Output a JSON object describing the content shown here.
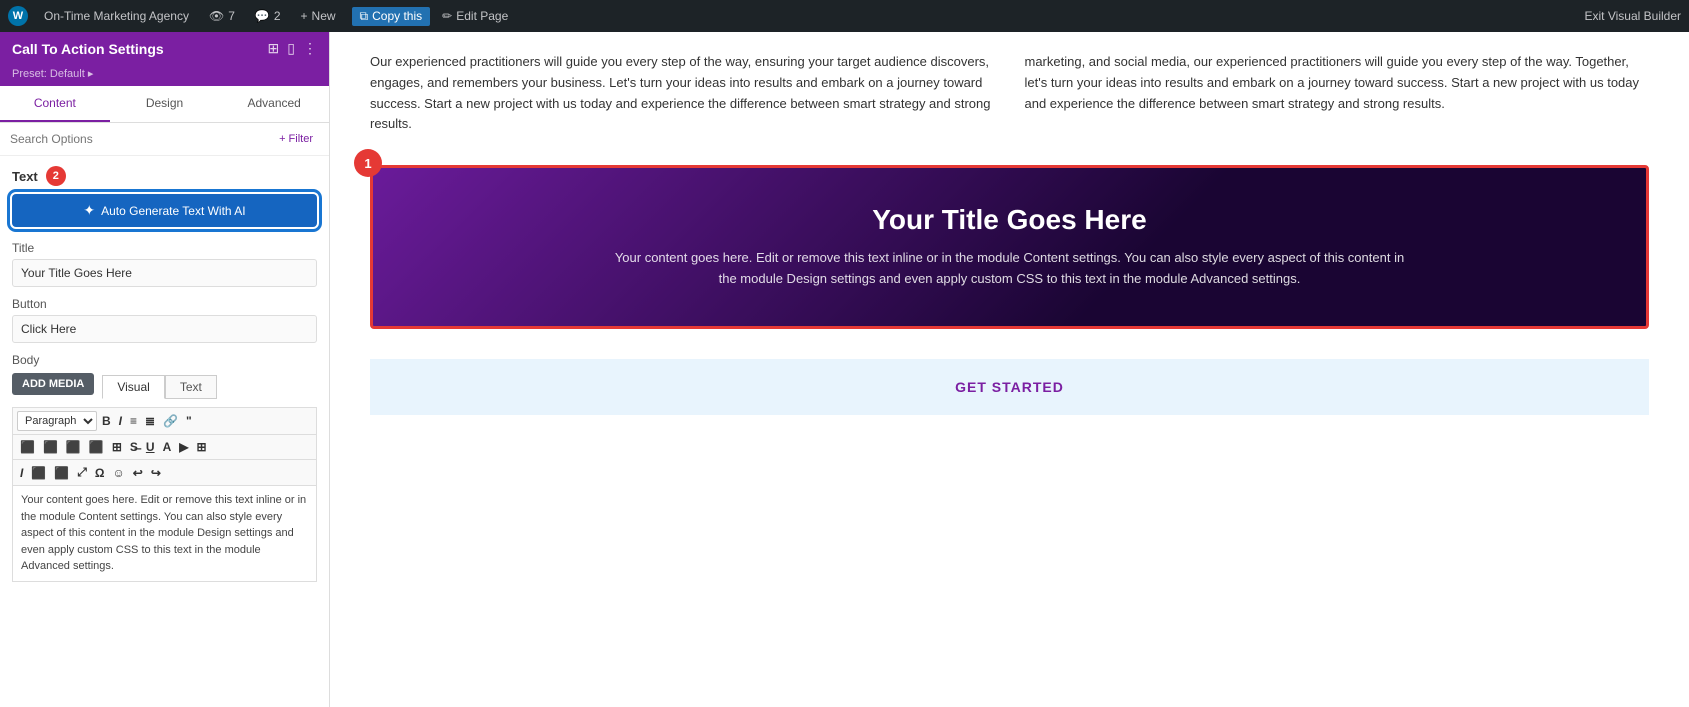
{
  "adminBar": {
    "wpIcon": "W",
    "agency": "On-Time Marketing Agency",
    "views": "7",
    "comments": "2",
    "newLabel": "New",
    "copyLabel": "Copy this",
    "editLabel": "Edit Page",
    "exitLabel": "Exit Visual Builder"
  },
  "panel": {
    "title": "Call To Action Settings",
    "preset": "Preset: Default ▸",
    "tabs": [
      "Content",
      "Design",
      "Advanced"
    ],
    "activeTab": "Content",
    "searchPlaceholder": "Search Options",
    "filterLabel": "+ Filter"
  },
  "textSection": {
    "label": "Text",
    "badge": "2",
    "aiButtonLabel": "Auto Generate Text With AI"
  },
  "titleField": {
    "label": "Title",
    "value": "Your Title Goes Here"
  },
  "buttonField": {
    "label": "Button",
    "value": "Click Here"
  },
  "bodyField": {
    "label": "Body",
    "addMediaLabel": "ADD MEDIA",
    "tabs": [
      "Visual",
      "Text"
    ],
    "activeTab": "Visual",
    "paragraphLabel": "Paragraph",
    "content": "Your content goes here. Edit or remove this text inline or in the module Content settings. You can also style every aspect of this content in the module Design settings and even apply custom CSS to this text in the module Advanced settings."
  },
  "mainContent": {
    "para1": "Our experienced practitioners will guide you every step of the way, ensuring your target audience discovers, engages, and remembers your business. Let's turn your ideas into results and embark on a journey toward success. Start a new project with us today and experience the difference between smart strategy and strong results.",
    "para2": "marketing, and social media, our experienced practitioners will guide you every step of the way. Together, let's turn your ideas into results and embark on a journey toward success. Start a new project with us today and experience the difference between smart strategy and strong results."
  },
  "ctaModule": {
    "badge": "1",
    "title": "Your Title Goes Here",
    "body": "Your content goes here. Edit or remove this text inline or in the module Content settings. You can also style every aspect of this content in the module Design settings and even apply custom CSS to this text in the module Advanced settings."
  },
  "bottomSection": {
    "label": "GET STARTED"
  },
  "toolbar": {
    "boldLabel": "B",
    "italicLabel": "I",
    "linkLabel": "🔗",
    "quoteLabel": "❝"
  },
  "colors": {
    "panelHeaderBg": "#7b1fa2",
    "activeTabColor": "#7b1fa2",
    "aiButtonBg": "#1565c0",
    "badgeBg": "#e53935",
    "ctaBorder": "#e53935"
  }
}
